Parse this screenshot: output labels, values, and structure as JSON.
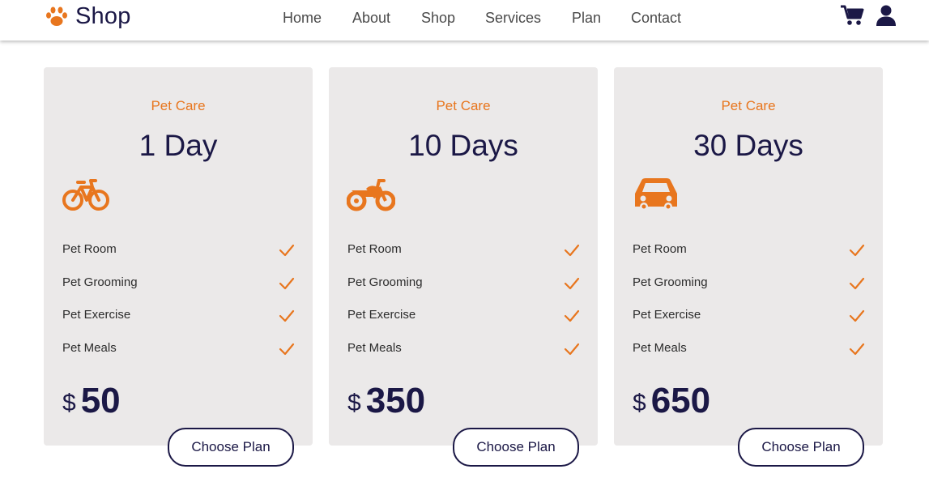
{
  "brand": {
    "name": "Shop",
    "icon": "paw-icon"
  },
  "nav": {
    "links": [
      "Home",
      "About",
      "Shop",
      "Services",
      "Plan",
      "Contact"
    ],
    "icons": [
      "cart-icon",
      "user-icon"
    ]
  },
  "colors": {
    "accent": "#e8761e",
    "dark": "#1b1846",
    "card_bg": "#ebe9e9"
  },
  "plans": [
    {
      "label": "Pet Care",
      "duration": "1 Day",
      "vehicle_icon": "bicycle-icon",
      "features": [
        "Pet Room",
        "Pet Grooming",
        "Pet Exercise",
        "Pet Meals"
      ],
      "currency": "$",
      "price": "50",
      "button": "Choose Plan"
    },
    {
      "label": "Pet Care",
      "duration": "10 Days",
      "vehicle_icon": "motorcycle-icon",
      "features": [
        "Pet Room",
        "Pet Grooming",
        "Pet Exercise",
        "Pet Meals"
      ],
      "currency": "$",
      "price": "350",
      "button": "Choose Plan"
    },
    {
      "label": "Pet Care",
      "duration": "30 Days",
      "vehicle_icon": "car-icon",
      "features": [
        "Pet Room",
        "Pet Grooming",
        "Pet Exercise",
        "Pet Meals"
      ],
      "currency": "$",
      "price": "650",
      "button": "Choose Plan"
    }
  ]
}
